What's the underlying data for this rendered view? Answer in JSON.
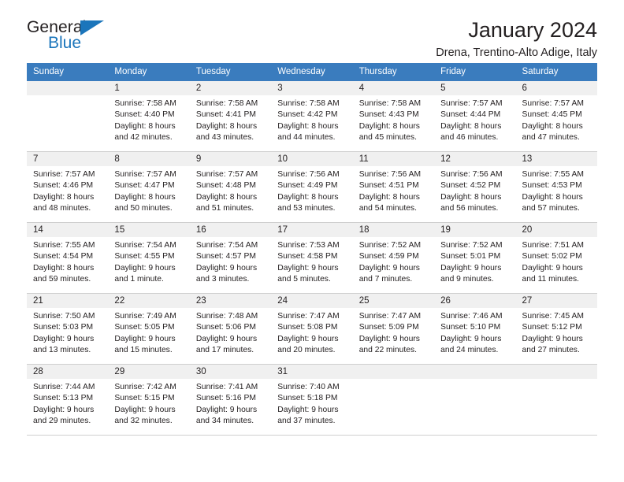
{
  "brand": {
    "name_part1": "General",
    "name_part2": "Blue"
  },
  "header": {
    "title": "January 2024",
    "subtitle": "Drena, Trentino-Alto Adige, Italy"
  },
  "weekdays": [
    "Sunday",
    "Monday",
    "Tuesday",
    "Wednesday",
    "Thursday",
    "Friday",
    "Saturday"
  ],
  "colors": {
    "header_blue": "#3a7cbe",
    "logo_blue": "#1b75bb",
    "daynum_bg": "#f0f0f0",
    "grid_line": "#cfcfcf",
    "text": "#231f20"
  },
  "weeks": [
    [
      {
        "day": "",
        "empty": true
      },
      {
        "day": "1",
        "sunrise": "Sunrise: 7:58 AM",
        "sunset": "Sunset: 4:40 PM",
        "daylight_line1": "Daylight: 8 hours",
        "daylight_line2": "and 42 minutes."
      },
      {
        "day": "2",
        "sunrise": "Sunrise: 7:58 AM",
        "sunset": "Sunset: 4:41 PM",
        "daylight_line1": "Daylight: 8 hours",
        "daylight_line2": "and 43 minutes."
      },
      {
        "day": "3",
        "sunrise": "Sunrise: 7:58 AM",
        "sunset": "Sunset: 4:42 PM",
        "daylight_line1": "Daylight: 8 hours",
        "daylight_line2": "and 44 minutes."
      },
      {
        "day": "4",
        "sunrise": "Sunrise: 7:58 AM",
        "sunset": "Sunset: 4:43 PM",
        "daylight_line1": "Daylight: 8 hours",
        "daylight_line2": "and 45 minutes."
      },
      {
        "day": "5",
        "sunrise": "Sunrise: 7:57 AM",
        "sunset": "Sunset: 4:44 PM",
        "daylight_line1": "Daylight: 8 hours",
        "daylight_line2": "and 46 minutes."
      },
      {
        "day": "6",
        "sunrise": "Sunrise: 7:57 AM",
        "sunset": "Sunset: 4:45 PM",
        "daylight_line1": "Daylight: 8 hours",
        "daylight_line2": "and 47 minutes."
      }
    ],
    [
      {
        "day": "7",
        "sunrise": "Sunrise: 7:57 AM",
        "sunset": "Sunset: 4:46 PM",
        "daylight_line1": "Daylight: 8 hours",
        "daylight_line2": "and 48 minutes."
      },
      {
        "day": "8",
        "sunrise": "Sunrise: 7:57 AM",
        "sunset": "Sunset: 4:47 PM",
        "daylight_line1": "Daylight: 8 hours",
        "daylight_line2": "and 50 minutes."
      },
      {
        "day": "9",
        "sunrise": "Sunrise: 7:57 AM",
        "sunset": "Sunset: 4:48 PM",
        "daylight_line1": "Daylight: 8 hours",
        "daylight_line2": "and 51 minutes."
      },
      {
        "day": "10",
        "sunrise": "Sunrise: 7:56 AM",
        "sunset": "Sunset: 4:49 PM",
        "daylight_line1": "Daylight: 8 hours",
        "daylight_line2": "and 53 minutes."
      },
      {
        "day": "11",
        "sunrise": "Sunrise: 7:56 AM",
        "sunset": "Sunset: 4:51 PM",
        "daylight_line1": "Daylight: 8 hours",
        "daylight_line2": "and 54 minutes."
      },
      {
        "day": "12",
        "sunrise": "Sunrise: 7:56 AM",
        "sunset": "Sunset: 4:52 PM",
        "daylight_line1": "Daylight: 8 hours",
        "daylight_line2": "and 56 minutes."
      },
      {
        "day": "13",
        "sunrise": "Sunrise: 7:55 AM",
        "sunset": "Sunset: 4:53 PM",
        "daylight_line1": "Daylight: 8 hours",
        "daylight_line2": "and 57 minutes."
      }
    ],
    [
      {
        "day": "14",
        "sunrise": "Sunrise: 7:55 AM",
        "sunset": "Sunset: 4:54 PM",
        "daylight_line1": "Daylight: 8 hours",
        "daylight_line2": "and 59 minutes."
      },
      {
        "day": "15",
        "sunrise": "Sunrise: 7:54 AM",
        "sunset": "Sunset: 4:55 PM",
        "daylight_line1": "Daylight: 9 hours",
        "daylight_line2": "and 1 minute."
      },
      {
        "day": "16",
        "sunrise": "Sunrise: 7:54 AM",
        "sunset": "Sunset: 4:57 PM",
        "daylight_line1": "Daylight: 9 hours",
        "daylight_line2": "and 3 minutes."
      },
      {
        "day": "17",
        "sunrise": "Sunrise: 7:53 AM",
        "sunset": "Sunset: 4:58 PM",
        "daylight_line1": "Daylight: 9 hours",
        "daylight_line2": "and 5 minutes."
      },
      {
        "day": "18",
        "sunrise": "Sunrise: 7:52 AM",
        "sunset": "Sunset: 4:59 PM",
        "daylight_line1": "Daylight: 9 hours",
        "daylight_line2": "and 7 minutes."
      },
      {
        "day": "19",
        "sunrise": "Sunrise: 7:52 AM",
        "sunset": "Sunset: 5:01 PM",
        "daylight_line1": "Daylight: 9 hours",
        "daylight_line2": "and 9 minutes."
      },
      {
        "day": "20",
        "sunrise": "Sunrise: 7:51 AM",
        "sunset": "Sunset: 5:02 PM",
        "daylight_line1": "Daylight: 9 hours",
        "daylight_line2": "and 11 minutes."
      }
    ],
    [
      {
        "day": "21",
        "sunrise": "Sunrise: 7:50 AM",
        "sunset": "Sunset: 5:03 PM",
        "daylight_line1": "Daylight: 9 hours",
        "daylight_line2": "and 13 minutes."
      },
      {
        "day": "22",
        "sunrise": "Sunrise: 7:49 AM",
        "sunset": "Sunset: 5:05 PM",
        "daylight_line1": "Daylight: 9 hours",
        "daylight_line2": "and 15 minutes."
      },
      {
        "day": "23",
        "sunrise": "Sunrise: 7:48 AM",
        "sunset": "Sunset: 5:06 PM",
        "daylight_line1": "Daylight: 9 hours",
        "daylight_line2": "and 17 minutes."
      },
      {
        "day": "24",
        "sunrise": "Sunrise: 7:47 AM",
        "sunset": "Sunset: 5:08 PM",
        "daylight_line1": "Daylight: 9 hours",
        "daylight_line2": "and 20 minutes."
      },
      {
        "day": "25",
        "sunrise": "Sunrise: 7:47 AM",
        "sunset": "Sunset: 5:09 PM",
        "daylight_line1": "Daylight: 9 hours",
        "daylight_line2": "and 22 minutes."
      },
      {
        "day": "26",
        "sunrise": "Sunrise: 7:46 AM",
        "sunset": "Sunset: 5:10 PM",
        "daylight_line1": "Daylight: 9 hours",
        "daylight_line2": "and 24 minutes."
      },
      {
        "day": "27",
        "sunrise": "Sunrise: 7:45 AM",
        "sunset": "Sunset: 5:12 PM",
        "daylight_line1": "Daylight: 9 hours",
        "daylight_line2": "and 27 minutes."
      }
    ],
    [
      {
        "day": "28",
        "sunrise": "Sunrise: 7:44 AM",
        "sunset": "Sunset: 5:13 PM",
        "daylight_line1": "Daylight: 9 hours",
        "daylight_line2": "and 29 minutes."
      },
      {
        "day": "29",
        "sunrise": "Sunrise: 7:42 AM",
        "sunset": "Sunset: 5:15 PM",
        "daylight_line1": "Daylight: 9 hours",
        "daylight_line2": "and 32 minutes."
      },
      {
        "day": "30",
        "sunrise": "Sunrise: 7:41 AM",
        "sunset": "Sunset: 5:16 PM",
        "daylight_line1": "Daylight: 9 hours",
        "daylight_line2": "and 34 minutes."
      },
      {
        "day": "31",
        "sunrise": "Sunrise: 7:40 AM",
        "sunset": "Sunset: 5:18 PM",
        "daylight_line1": "Daylight: 9 hours",
        "daylight_line2": "and 37 minutes."
      },
      {
        "day": "",
        "empty": true
      },
      {
        "day": "",
        "empty": true
      },
      {
        "day": "",
        "empty": true
      }
    ]
  ]
}
